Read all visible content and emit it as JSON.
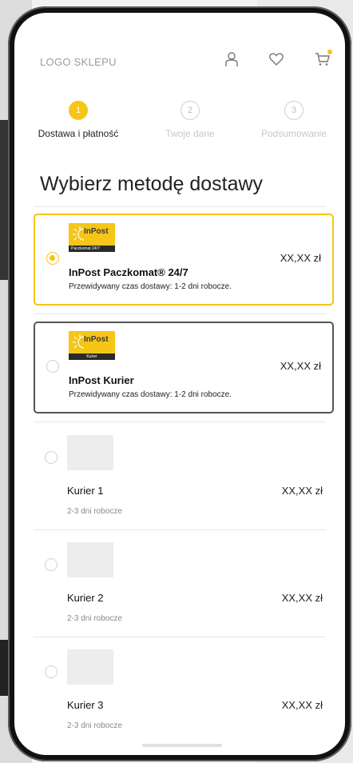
{
  "header": {
    "logo": "LOGO SKLEPU",
    "icons": [
      "user-icon",
      "heart-icon",
      "cart-icon"
    ],
    "accent": "#f5c518"
  },
  "steps": [
    {
      "num": "1",
      "label": "Dostawa i płatność",
      "active": true
    },
    {
      "num": "2",
      "label": "Twoje dane",
      "active": false
    },
    {
      "num": "3",
      "label": "Podsumowanie",
      "active": false
    }
  ],
  "title": "Wybierz metodę dostawy",
  "options": [
    {
      "logo_word": "InPost",
      "logo_bar": "Paczkomat 24/7",
      "name": "InPost Paczkomat® 24/7",
      "price": "XX,XX zł",
      "desc": "Przewidywany czas dostawy: 1-2 dni robocze.",
      "selected": true
    },
    {
      "logo_word": "InPost",
      "logo_bar": "Kurier",
      "name": "InPost Kurier",
      "price": "XX,XX zł",
      "desc": "Przewidywany czas dostawy: 1-2 dni robocze.",
      "selected": false
    },
    {
      "name": "Kurier 1",
      "price": "XX,XX zł",
      "desc": "2-3 dni robocze",
      "selected": false
    },
    {
      "name": "Kurier 2",
      "price": "XX,XX zł",
      "desc": "2-3 dni robocze",
      "selected": false
    },
    {
      "name": "Kurier 3",
      "price": "XX,XX zł",
      "desc": "2-3 dni robocze",
      "selected": false
    }
  ]
}
